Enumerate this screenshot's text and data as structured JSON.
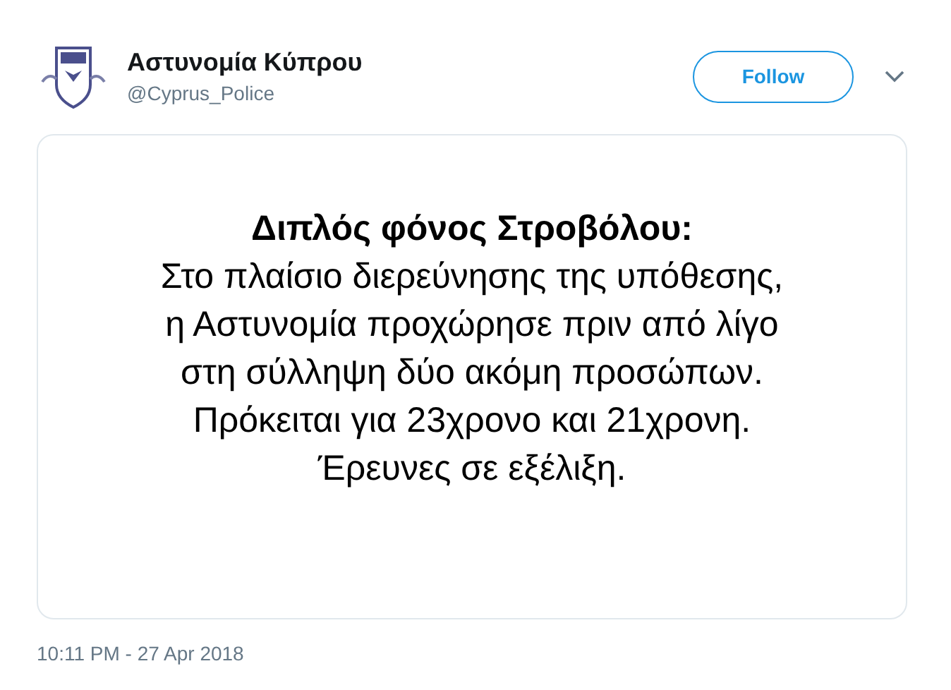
{
  "account": {
    "name": "Αστυνομία Κύπρου",
    "handle": "@Cyprus_Police"
  },
  "follow_button": {
    "label": "Follow"
  },
  "image_card": {
    "title": "Διπλός φόνος Στροβόλου:",
    "lines": [
      "Στο πλαίσιο διερεύνησης της υπόθεσης,",
      "η Αστυνομία προχώρησε πριν από λίγο",
      "στη σύλληψη δύο ακόμη προσώπων.",
      "Πρόκειται για 23χρονο και 21χρονη.",
      "Έρευνες σε εξέλιξη."
    ]
  },
  "timestamp": "10:11 PM - 27 Apr 2018"
}
